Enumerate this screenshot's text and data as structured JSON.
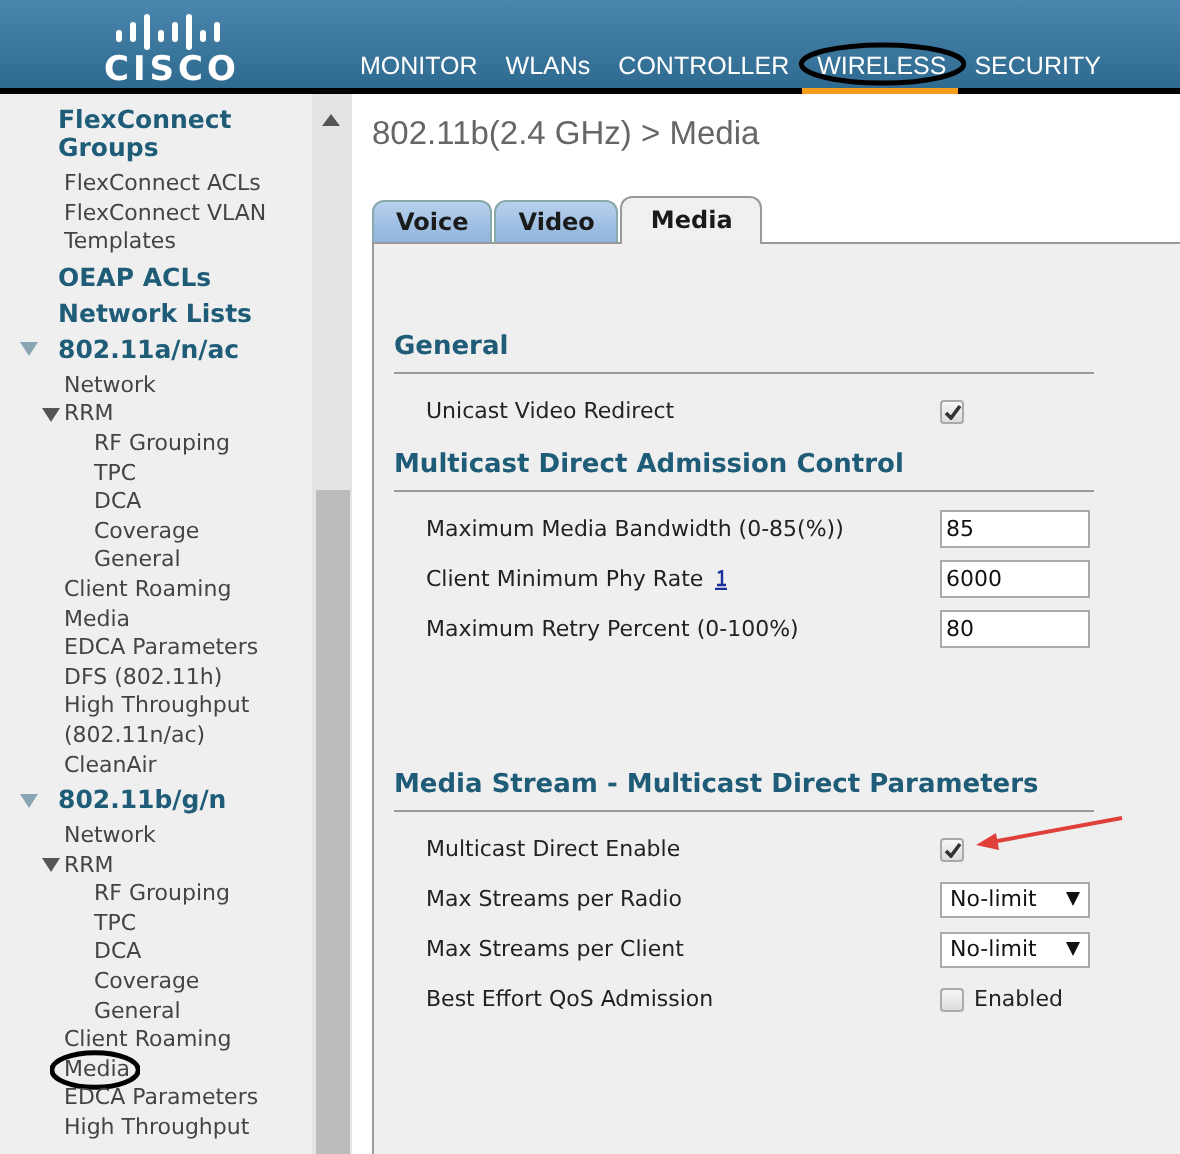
{
  "header": {
    "logo": "CISCO",
    "menu": [
      {
        "label": "MONITOR",
        "selected": false,
        "circled": false
      },
      {
        "label": "WLANs",
        "selected": false,
        "circled": false
      },
      {
        "label": "CONTROLLER",
        "selected": false,
        "circled": false
      },
      {
        "label": "WIRELESS",
        "selected": true,
        "circled": true
      },
      {
        "label": "SECURITY",
        "selected": false,
        "circled": false
      }
    ]
  },
  "sidebar": {
    "items": [
      {
        "label": "FlexConnect Groups",
        "kind": "heading",
        "children": [
          {
            "label": "FlexConnect ACLs"
          },
          {
            "label": "FlexConnect VLAN Templates"
          }
        ]
      },
      {
        "label": "OEAP ACLs",
        "kind": "heading"
      },
      {
        "label": "Network Lists",
        "kind": "heading"
      },
      {
        "label": "802.11a/n/ac",
        "kind": "heading",
        "expanded": true,
        "children": [
          {
            "label": "Network"
          },
          {
            "label": "RRM",
            "expanded": true,
            "children": [
              {
                "label": "RF Grouping"
              },
              {
                "label": "TPC"
              },
              {
                "label": "DCA"
              },
              {
                "label": "Coverage"
              },
              {
                "label": "General"
              }
            ]
          },
          {
            "label": "Client Roaming"
          },
          {
            "label": "Media"
          },
          {
            "label": "EDCA Parameters"
          },
          {
            "label": "DFS (802.11h)"
          },
          {
            "label": "High Throughput (802.11n/ac)"
          },
          {
            "label": "CleanAir"
          }
        ]
      },
      {
        "label": "802.11b/g/n",
        "kind": "heading",
        "expanded": true,
        "children": [
          {
            "label": "Network"
          },
          {
            "label": "RRM",
            "expanded": true,
            "children": [
              {
                "label": "RF Grouping"
              },
              {
                "label": "TPC"
              },
              {
                "label": "DCA"
              },
              {
                "label": "Coverage"
              },
              {
                "label": "General"
              }
            ]
          },
          {
            "label": "Client Roaming"
          },
          {
            "label": "Media",
            "circled": true
          },
          {
            "label": "EDCA Parameters"
          },
          {
            "label": "High Throughput"
          }
        ]
      }
    ]
  },
  "page": {
    "title": "802.11b(2.4 GHz) > Media",
    "tabs": [
      {
        "label": "Voice",
        "selected": false
      },
      {
        "label": "Video",
        "selected": false
      },
      {
        "label": "Media",
        "selected": true
      }
    ],
    "sections": [
      {
        "title": "General",
        "rows": [
          {
            "kind": "checkbox",
            "label": "Unicast Video Redirect",
            "checked": true
          }
        ]
      },
      {
        "title": "Multicast Direct Admission Control",
        "rows": [
          {
            "kind": "input",
            "label": "Maximum Media Bandwidth (0-85(%))",
            "value": "85"
          },
          {
            "kind": "input",
            "label": "Client Minimum Phy Rate",
            "value": "6000",
            "help_icon": true
          },
          {
            "kind": "input",
            "label": "Maximum Retry Percent (0-100%)",
            "value": "80"
          }
        ]
      },
      {
        "title": "Media Stream - Multicast Direct Parameters",
        "rows": [
          {
            "kind": "checkbox",
            "label": "Multicast Direct Enable",
            "checked": true,
            "annotated": true
          },
          {
            "kind": "select",
            "label": "Max Streams per Radio",
            "value": "No-limit"
          },
          {
            "kind": "select",
            "label": "Max Streams per Client",
            "value": "No-limit"
          },
          {
            "kind": "checkbox",
            "label": "Best Effort QoS Admission",
            "checked": false,
            "caption": "Enabled"
          }
        ]
      }
    ]
  }
}
